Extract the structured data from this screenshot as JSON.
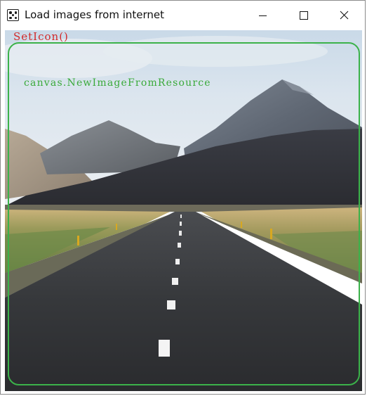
{
  "window": {
    "title": "Load images from internet",
    "controls": {
      "minimize_icon": "minimize-icon",
      "maximize_icon": "maximize-icon",
      "close_icon": "close-icon"
    }
  },
  "content": {
    "seticon_text": "SetIcon()",
    "canvas_text": "canvas.NewImageFromResource",
    "image_icon": "road-mountains-photo"
  },
  "colors": {
    "seticon_text": "#d22a2a",
    "canvas_text": "#3aaa3a",
    "frame_border": "#3bb24a"
  }
}
